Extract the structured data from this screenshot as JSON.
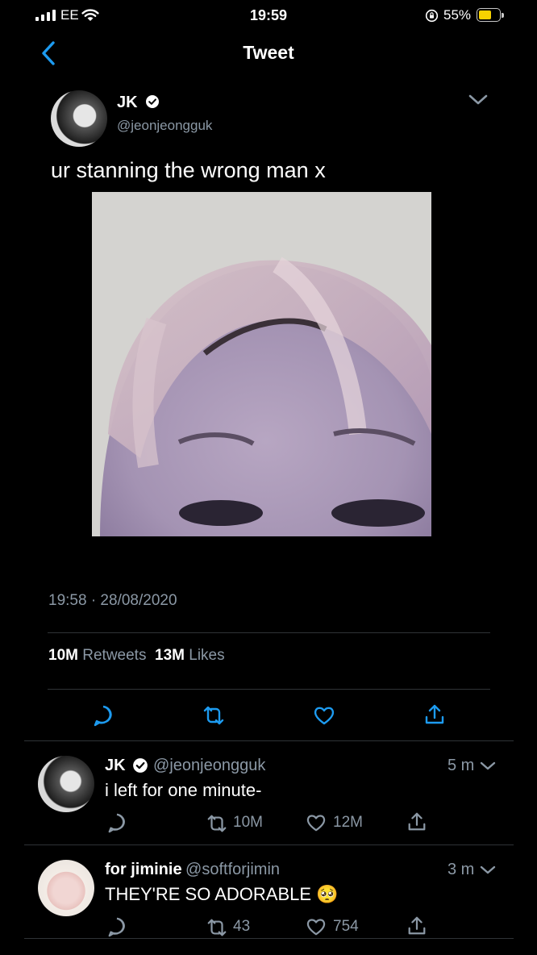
{
  "status_bar": {
    "carrier": "EE",
    "time": "19:59",
    "battery_percent": "55%",
    "battery_level": 0.55,
    "icons": [
      "signal-icon",
      "wifi-icon",
      "orientation-lock-icon",
      "battery-icon"
    ]
  },
  "nav": {
    "title": "Tweet",
    "back_icon": "chevron-left-icon"
  },
  "main_tweet": {
    "author_name": "JK",
    "author_handle": "@jeonjeongguk",
    "text": "ur stanning the wrong man x",
    "timestamp": "19:58 · 28/08/2020",
    "retweets_count": "10M",
    "retweets_label": "Retweets",
    "likes_count": "13M",
    "likes_label": "Likes",
    "actions": [
      "reply-icon",
      "retweet-icon",
      "like-icon",
      "share-icon"
    ]
  },
  "replies": [
    {
      "author_name": "JK",
      "author_handle": "@jeonjeongguk",
      "time": "5 m",
      "text": "i left for one minute-",
      "retweets": "10M",
      "likes": "12M"
    },
    {
      "author_name": "for jiminie",
      "author_handle": "@softforjimin",
      "time": "3 m",
      "text": "THEY'RE SO ADORABLE 🥺",
      "retweets": "43",
      "likes": "754"
    }
  ],
  "colors": {
    "background": "#000000",
    "secondary_text": "#8b98a5",
    "accent_blue": "#1d9bf0",
    "divider": "#2f3336",
    "battery": "#f7d200"
  }
}
